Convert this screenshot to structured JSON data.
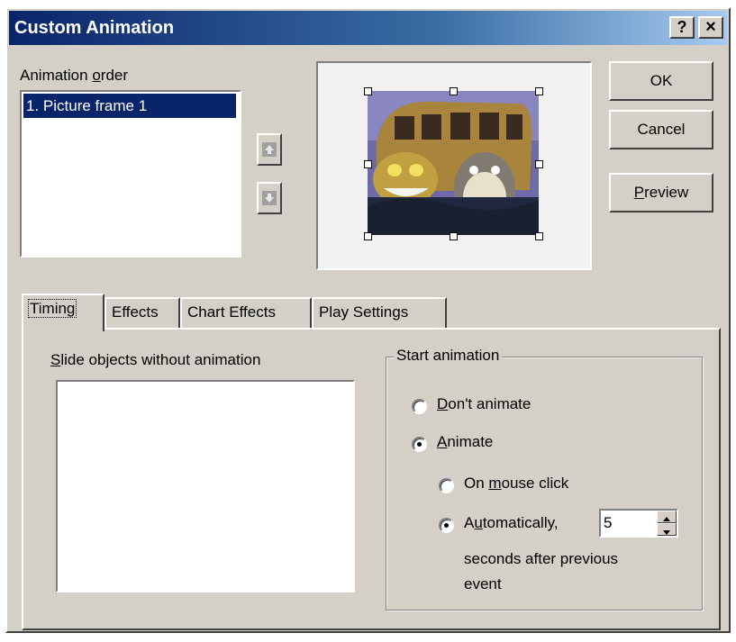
{
  "window": {
    "title": "Custom Animation",
    "help_label": "?",
    "close_label": "×"
  },
  "animation_order": {
    "label_pre": "Animation ",
    "label_key": "o",
    "label_post": "rder",
    "items": [
      "1. Picture frame 1"
    ],
    "selected_index": 0
  },
  "buttons": {
    "ok": "OK",
    "cancel": "Cancel",
    "preview_key": "P",
    "preview_rest": "review"
  },
  "tabs": [
    {
      "label": "Timing",
      "active": true
    },
    {
      "label": "Effects",
      "active": false
    },
    {
      "label": "Chart Effects",
      "active": false
    },
    {
      "label": "Play Settings",
      "active": false
    }
  ],
  "timing": {
    "slide_objects_key": "S",
    "slide_objects_rest": "lide objects without animation",
    "start_animation_title": "Start animation",
    "dont_animate_key": "D",
    "dont_animate_rest": "on't animate",
    "animate_key": "A",
    "animate_rest": "nimate",
    "on_mouse_click_pre": "On ",
    "on_mouse_click_key": "m",
    "on_mouse_click_post": "ouse click",
    "automatically_pre": "A",
    "automatically_key": "u",
    "automatically_post": "tomatically,",
    "seconds_value": "5",
    "seconds_after_line1": "seconds after previous",
    "seconds_after_line2": "event",
    "start_option": "animate",
    "trigger_option": "automatically"
  },
  "colors": {
    "dialog_face": "#d4d0c8",
    "title_start": "#0a246a",
    "title_end": "#a6caf0",
    "selection": "#0a246a"
  }
}
